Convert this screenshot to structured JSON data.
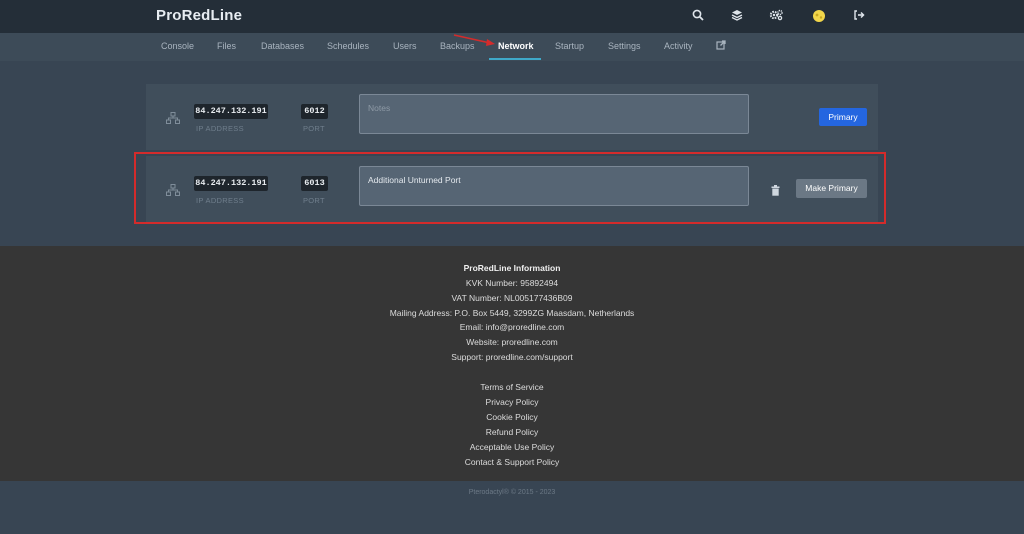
{
  "header": {
    "brand": "ProRedLine"
  },
  "header_icons": [
    "search-icon",
    "layers-icon",
    "cogs-icon",
    "avatar",
    "sign-out-icon"
  ],
  "tabs": [
    {
      "label": "Console",
      "active": false
    },
    {
      "label": "Files",
      "active": false
    },
    {
      "label": "Databases",
      "active": false
    },
    {
      "label": "Schedules",
      "active": false
    },
    {
      "label": "Users",
      "active": false
    },
    {
      "label": "Backups",
      "active": false
    },
    {
      "label": "Network",
      "active": true
    },
    {
      "label": "Startup",
      "active": false
    },
    {
      "label": "Settings",
      "active": false
    },
    {
      "label": "Activity",
      "active": false
    }
  ],
  "allocations": [
    {
      "ip": "84.247.132.191",
      "ip_label": "IP ADDRESS",
      "port": "6012",
      "port_label": "PORT",
      "notes_placeholder": "Notes",
      "notes_value": "",
      "action": "Primary"
    },
    {
      "ip": "84.247.132.191",
      "ip_label": "IP ADDRESS",
      "port": "6013",
      "port_label": "PORT",
      "notes_placeholder": "Notes",
      "notes_value": "Additional Unturned Port",
      "action": "Make Primary"
    }
  ],
  "footer": {
    "lines": [
      "ProRedLine Information",
      "KVK Number: 95892494",
      "VAT Number: NL005177436B09",
      "Mailing Address: P.O. Box 5449, 3299ZG Maasdam, Netherlands",
      "Email: info@proredline.com",
      "Website: proredline.com",
      "Support: proredline.com/support"
    ],
    "links": [
      "Terms of Service",
      "Privacy Policy",
      "Cookie Policy",
      "Refund Policy",
      "Acceptable Use Policy",
      "Contact & Support Policy"
    ],
    "copyright": "Pterodactyl® © 2015 - 2023"
  },
  "colors": {
    "accent": "#3fa9c9",
    "primary_button": "#2466e0",
    "highlight": "#d42b2b",
    "arrow": "#d42b2b"
  }
}
